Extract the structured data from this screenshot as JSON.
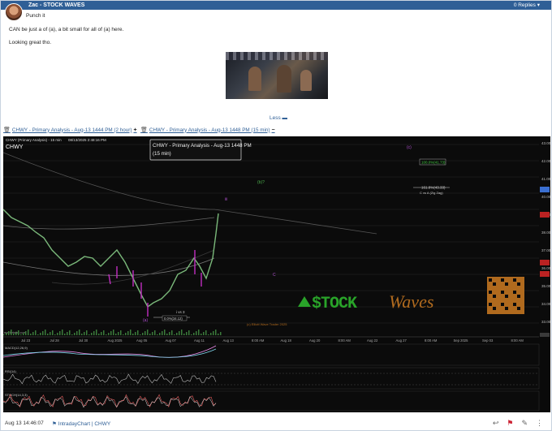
{
  "post": {
    "author": "Zac - STOCK WAVES",
    "replies": "0 Replies",
    "title": "Punch it",
    "line1": "CAN be just a of (a), a bit small for all of (a) here.",
    "line2": "Looking great tho.",
    "less_label": "Less"
  },
  "attachments": [
    {
      "label": "CHWY - Primary Analysis - Aug-13 1444 PM (2 hour)"
    },
    {
      "label": "CHWY - Primary Analysis - Aug-13 1448 PM (15 min)"
    }
  ],
  "chart": {
    "header_text": "CHWY (Primary Analysis) - 15 min",
    "header_date": "08/13/2025 2:48:16 PM",
    "symbol": "CHWY",
    "tooltip_line1": "CHWY - Primary Analysis - Aug-13 1448 PM",
    "tooltip_line2": "(15 min)",
    "watermark": "STOCKWaves",
    "copyright": "(c) Elliott Wave Trader 2025",
    "source": "marketsite.com",
    "label_w3": "i vs 3",
    "label_pct": "0.0%(34.12)",
    "label_target1": "100.0%(41.73)",
    "label_target2": "161.8%(43.33)",
    "label_target3": "C vs A (Zig Zag)",
    "date_labels": [
      "Jul 23",
      "Jul 28",
      "Jul 30",
      "Aug 2025",
      "Aug 05",
      "Aug 07",
      "Aug 11",
      "Aug 13",
      "8:00 AM",
      "Aug 18",
      "Aug 20",
      "8:00 AM",
      "Aug 22",
      "Aug 27",
      "8:00 AM",
      "Sep 2025",
      "Sep 03",
      "8:00 AM"
    ],
    "price_labels": [
      "43.00",
      "42.00",
      "41.00",
      "40.00",
      "39.00",
      "38.00",
      "37.00",
      "36.00",
      "35.00",
      "34.00",
      "33.00"
    ],
    "indicator1_label": "MACD(12,26,9)",
    "indicator2_label": "RSI(14)",
    "indicator3_label": "STOCH(14,3,3)"
  },
  "footer": {
    "timestamp": "Aug 13 14:46:07",
    "tag1": "IntradayChart",
    "tag2": "CHWY"
  },
  "colors": {
    "header_bg": "#2f5f96",
    "link": "#2f5f96",
    "watermark_green": "#29a329",
    "watermark_brown": "#b06a1e"
  }
}
